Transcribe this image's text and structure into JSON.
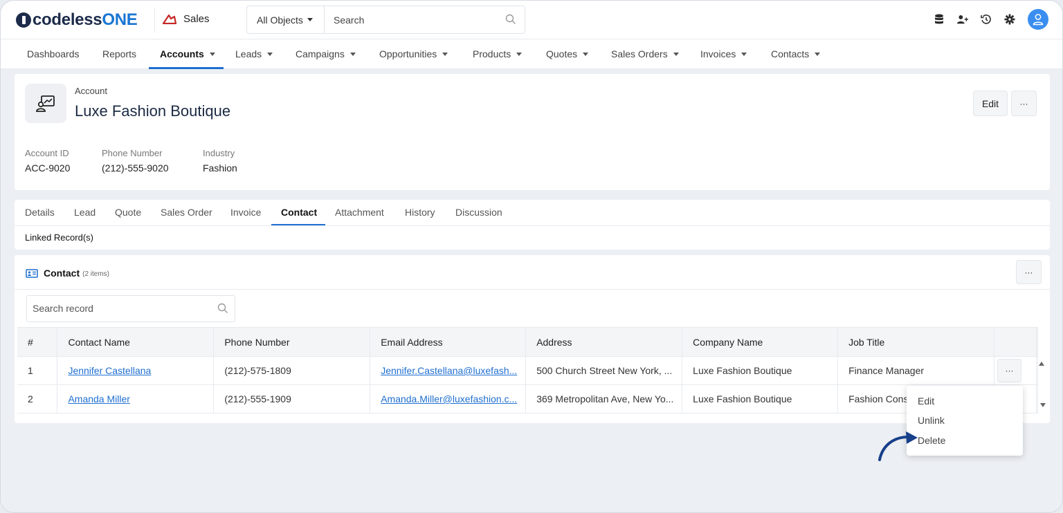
{
  "brand": {
    "logo_main": "codeless",
    "logo_accent": "ONE",
    "app_name": "Sales"
  },
  "search": {
    "object_selector": "All Objects",
    "placeholder": "Search"
  },
  "nav": {
    "items": [
      {
        "label": "Dashboards",
        "dropdown": false
      },
      {
        "label": "Reports",
        "dropdown": false
      },
      {
        "label": "Accounts",
        "dropdown": true,
        "active": true
      },
      {
        "label": "Leads",
        "dropdown": true
      },
      {
        "label": "Campaigns",
        "dropdown": true
      },
      {
        "label": "Opportunities",
        "dropdown": true
      },
      {
        "label": "Products",
        "dropdown": true
      },
      {
        "label": "Quotes",
        "dropdown": true
      },
      {
        "label": "Sales Orders",
        "dropdown": true
      },
      {
        "label": "Invoices",
        "dropdown": true
      },
      {
        "label": "Contacts",
        "dropdown": true
      }
    ]
  },
  "record": {
    "type": "Account",
    "name": "Luxe Fashion Boutique",
    "edit_label": "Edit",
    "more_label": "···",
    "fields": [
      {
        "label": "Account ID",
        "value": "ACC-9020"
      },
      {
        "label": "Phone Number",
        "value": "(212)-555-9020"
      },
      {
        "label": "Industry",
        "value": "Fashion"
      }
    ]
  },
  "tabs": {
    "items": [
      "Details",
      "Lead",
      "Quote",
      "Sales Order",
      "Invoice",
      "Contact",
      "Attachment",
      "History",
      "Discussion"
    ],
    "active": "Contact",
    "sub_label": "Linked Record(s)"
  },
  "contacts": {
    "title": "Contact",
    "count": "(2 items)",
    "more_label": "···",
    "search_placeholder": "Search record",
    "columns": [
      "#",
      "Contact Name",
      "Phone Number",
      "Email Address",
      "Address",
      "Company Name",
      "Job Title"
    ],
    "rows": [
      {
        "n": "1",
        "name": "Jennifer Castellana",
        "phone": "(212)-575-1809",
        "email": "Jennifer.Castellana@luxefash...",
        "address": "500 Church Street New York, ...",
        "company": "Luxe Fashion Boutique",
        "job": "Finance Manager"
      },
      {
        "n": "2",
        "name": "Amanda Miller",
        "phone": "(212)-555-1909",
        "email": "Amanda.Miller@luxefashion.c...",
        "address": "369 Metropolitan Ave, New Yo...",
        "company": "Luxe Fashion Boutique",
        "job": "Fashion Cons"
      }
    ],
    "row_more_label": "···"
  },
  "row_menu": {
    "items": [
      "Edit",
      "Unlink",
      "Delete"
    ]
  },
  "colors": {
    "accent": "#1f6fd0",
    "brand_dark": "#1c2b4a",
    "app_icon": "#c62828",
    "avatar": "#3a8ef0"
  }
}
